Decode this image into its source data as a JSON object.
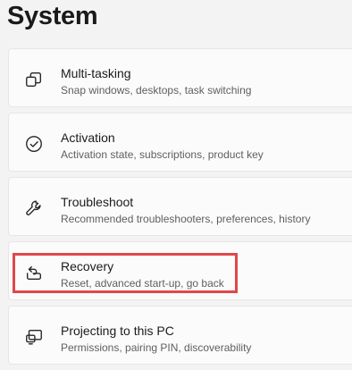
{
  "page": {
    "title": "System"
  },
  "items": [
    {
      "icon": "multitasking-icon",
      "title": "Multi-tasking",
      "subtitle": "Snap windows, desktops, task switching"
    },
    {
      "icon": "activation-icon",
      "title": "Activation",
      "subtitle": "Activation state, subscriptions, product key"
    },
    {
      "icon": "wrench-icon",
      "title": "Troubleshoot",
      "subtitle": "Recommended troubleshooters, preferences, history"
    },
    {
      "icon": "recovery-icon",
      "title": "Recovery",
      "subtitle": "Reset, advanced start-up, go back"
    },
    {
      "icon": "projecting-icon",
      "title": "Projecting to this PC",
      "subtitle": "Permissions, pairing PIN, discoverability"
    }
  ],
  "annotation": {
    "highlight_color": "#e0474c",
    "highlighted_item": "Recovery"
  }
}
